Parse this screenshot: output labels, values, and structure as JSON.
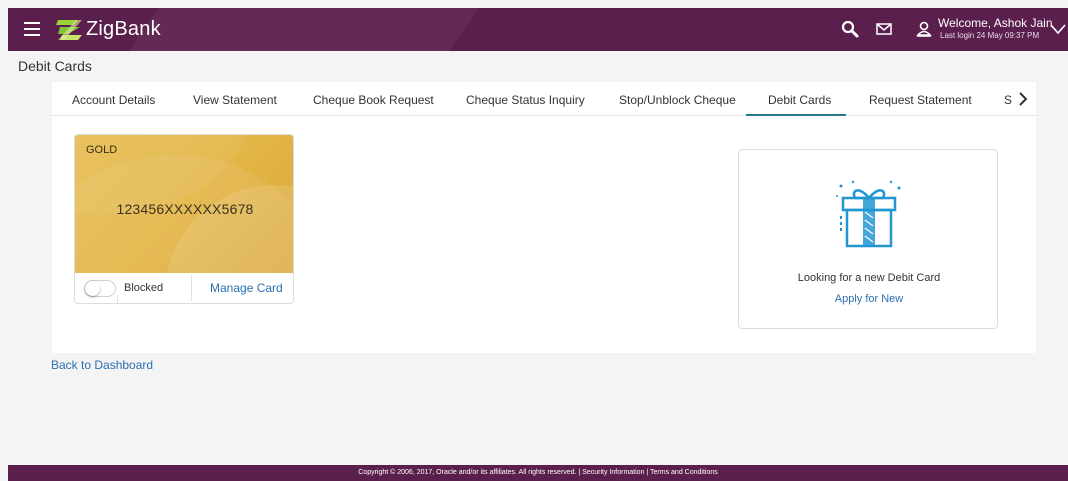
{
  "header": {
    "brand": "ZigBank",
    "welcome": "Welcome, Ashok Jain",
    "last_login": "Last login 24 May 09:37 PM"
  },
  "page": {
    "title": "Debit Cards"
  },
  "tabs": [
    {
      "label": "Account Details"
    },
    {
      "label": "View Statement"
    },
    {
      "label": "Cheque Book Request"
    },
    {
      "label": "Cheque Status Inquiry"
    },
    {
      "label": "Stop/Unblock Cheque"
    },
    {
      "label": "Debit Cards",
      "active": true
    },
    {
      "label": "Request Statement"
    },
    {
      "label": "S"
    }
  ],
  "card": {
    "type": "GOLD",
    "number": "123456XXXXXX5678",
    "status_label": "Blocked",
    "manage_label": "Manage Card",
    "colors": {
      "gold": "#e3b547"
    }
  },
  "promo": {
    "text": "Looking for a new Debit Card",
    "link": "Apply for New"
  },
  "back_link": "Back to Dashboard",
  "footer": {
    "text": "Copyright © 2006, 2017, Oracle and/or its affiliates. All rights reserved. | Security Information | Terms and Conditions"
  },
  "colors": {
    "header_bg": "#5b1f4d",
    "link": "#2a6fb0",
    "active_tab": "#2a7a8c",
    "gift_blue": "#2196d3"
  },
  "icons": [
    "menu-icon",
    "logo-icon",
    "search-icon",
    "mail-icon",
    "user-icon",
    "chevron-down-icon",
    "chevron-right-icon",
    "gift-icon"
  ]
}
